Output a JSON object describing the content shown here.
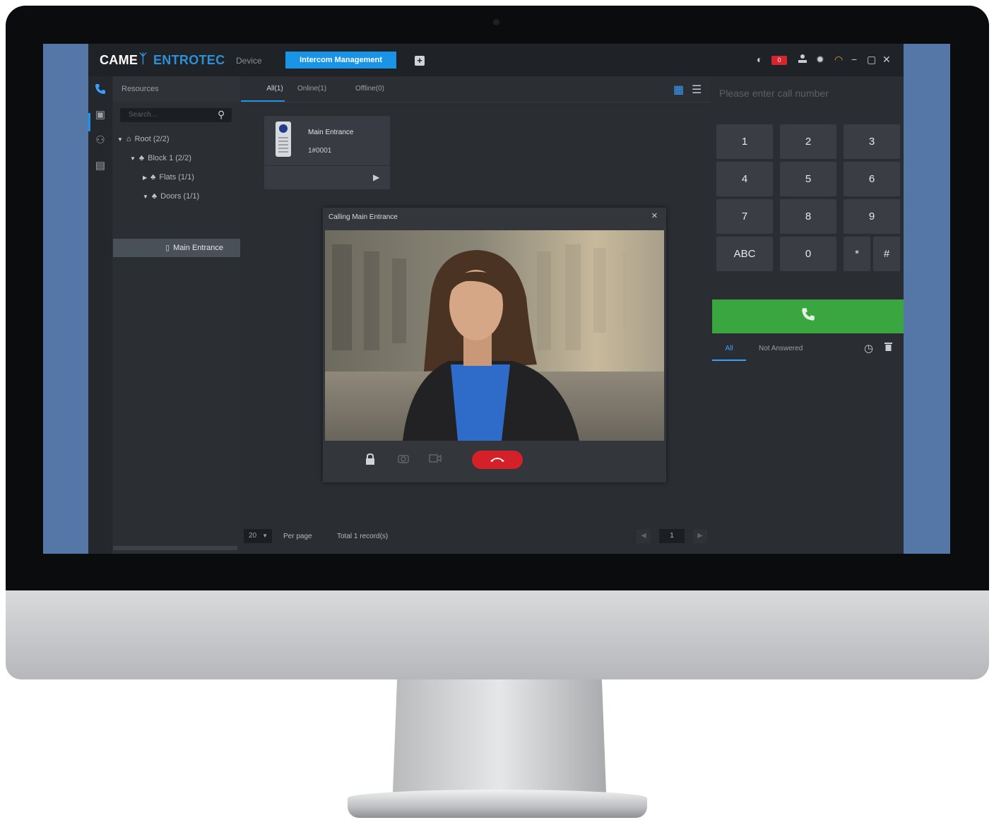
{
  "header": {
    "brand_part1": "CAME",
    "brand_part2": "ENTROTEC",
    "nav_device": "Device",
    "nav_intercom": "Intercom Management",
    "alarm_count": "0"
  },
  "sidebar": {
    "resources_title": "Resources",
    "search_placeholder": "Search...",
    "tree": {
      "root": "Root (2/2)",
      "block": "Block 1 (2/2)",
      "flats": "Flats (1/1)",
      "doors": "Doors (1/1)",
      "main_entrance": "Main Entrance"
    }
  },
  "tabs": {
    "all": "All(1)",
    "online": "Online(1)",
    "offline": "Offline(0)"
  },
  "device_card": {
    "name": "Main Entrance",
    "number": "1#0001"
  },
  "pagination": {
    "page_size": "20",
    "per_page": "Per page",
    "total": "Total 1 record(s)",
    "current_page": "1"
  },
  "call_dialog": {
    "title": "Calling Main Entrance"
  },
  "dialpad": {
    "placeholder": "Please enter call number",
    "keys": [
      "1",
      "2",
      "3",
      "4",
      "5",
      "6",
      "7",
      "8",
      "9",
      "ABC",
      "0",
      "*",
      "#"
    ]
  },
  "history": {
    "tab_all": "All",
    "tab_not_answered": "Not Answered"
  },
  "colors": {
    "accent": "#1994e6",
    "call_green": "#3aa640",
    "hangup_red": "#d42028",
    "brand_blue": "#2e8fd6"
  },
  "icons": {
    "call": "phone-icon",
    "hangup": "phone-hangup-icon",
    "unlock": "lock-icon",
    "snapshot": "camera-icon",
    "record": "video-icon",
    "history": "clock-icon",
    "delete": "trash-icon"
  }
}
